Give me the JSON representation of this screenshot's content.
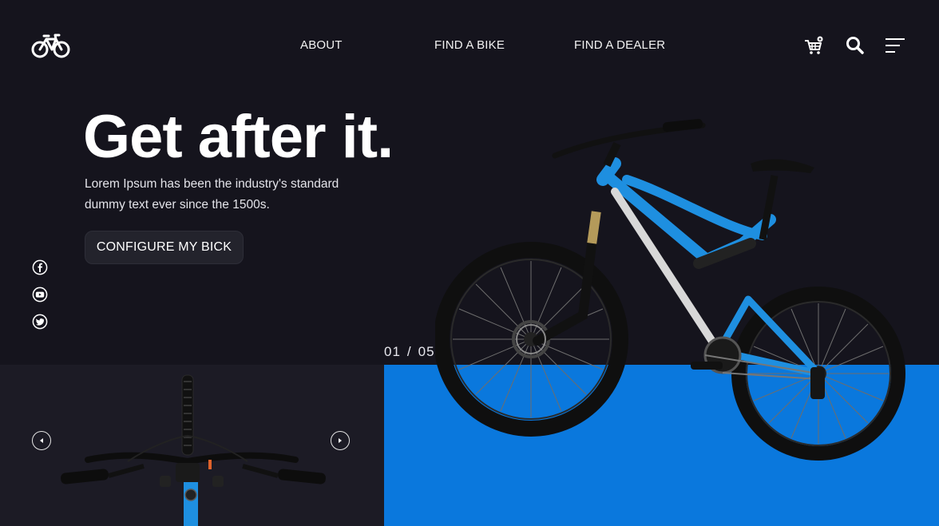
{
  "nav": {
    "links": [
      "ABOUT",
      "FIND A BIKE",
      "FIND A DEALER"
    ],
    "icons": [
      "bicycle-logo-icon",
      "cart-icon",
      "search-icon",
      "menu-icon"
    ]
  },
  "hero": {
    "title": "Get after it.",
    "description": "Lorem Ipsum has been the industry's standard dummy text ever since the 1500s.",
    "cta_label": "CONFIGURE MY BICK"
  },
  "social": [
    "facebook-icon",
    "youtube-icon",
    "twitter-icon"
  ],
  "slider": {
    "current": "01",
    "separator": "/",
    "total": "05"
  },
  "colors": {
    "background": "#15141d",
    "panel": "#1c1b25",
    "accent_blue": "#0a78dd",
    "bike_blue": "#1e8fe0",
    "text": "#ffffff"
  }
}
